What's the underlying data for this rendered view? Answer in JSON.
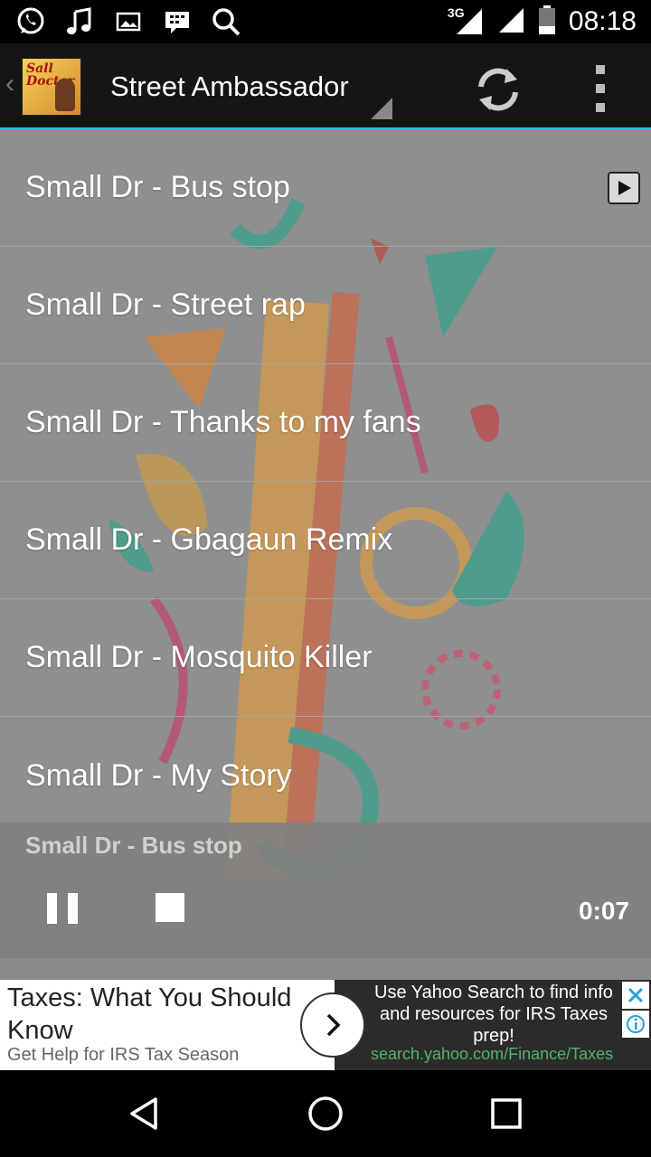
{
  "status_bar": {
    "time": "08:18",
    "network": "3G",
    "left_icons": [
      "whatsapp-icon",
      "music-note-icon",
      "image-icon",
      "bbm-icon",
      "search-icon"
    ]
  },
  "action_bar": {
    "title": "Street Ambassador",
    "accent_color": "#33b5e5"
  },
  "tracks": [
    {
      "label": "Small Dr - Bus stop"
    },
    {
      "label": "Small Dr - Street rap"
    },
    {
      "label": "Small Dr - Thanks to my fans"
    },
    {
      "label": "Small Dr - Gbagaun Remix"
    },
    {
      "label": "Small Dr - Mosquito Killer"
    },
    {
      "label": "Small Dr - My Story"
    }
  ],
  "player": {
    "now_playing": "Small Dr - Bus stop",
    "elapsed": "0:07"
  },
  "ad": {
    "title": "Taxes: What You Should Know",
    "subtitle": "Get Help for IRS Tax Season",
    "description": "Use Yahoo Search to find info and resources for IRS Taxes prep!",
    "url": "search.yahoo.com/Finance/Taxes"
  }
}
